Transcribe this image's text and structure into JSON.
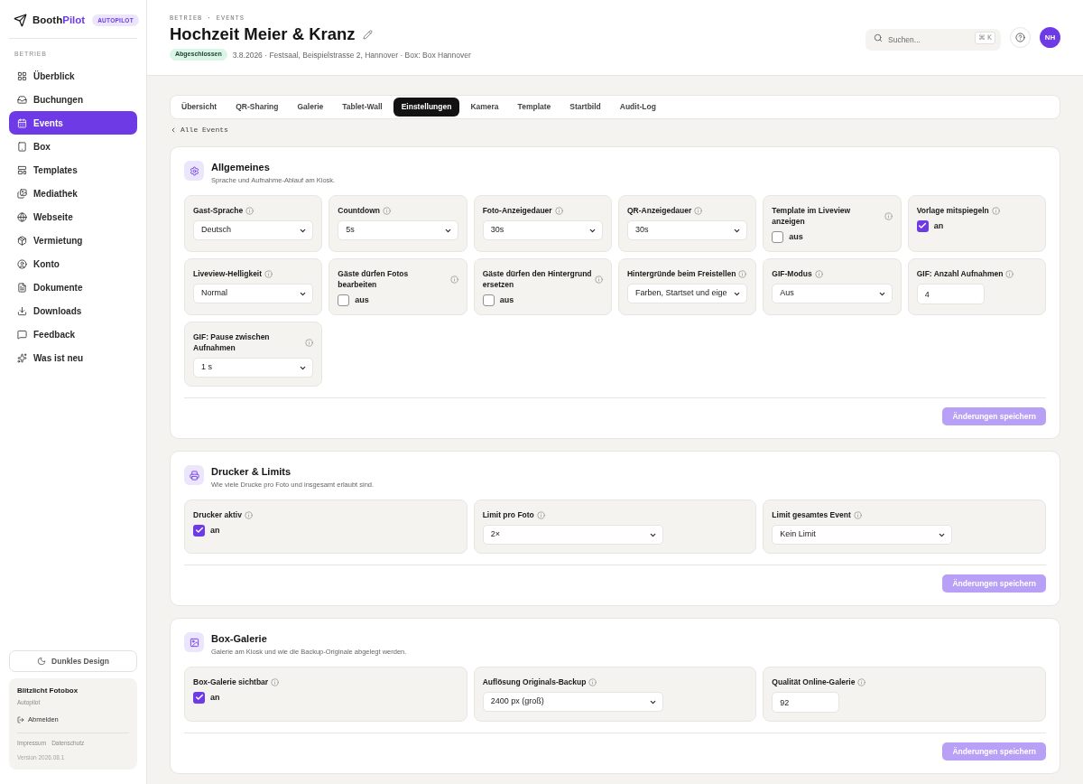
{
  "sidebar": {
    "brand": {
      "name": "Booth",
      "name_accent": "Pilot",
      "badge": "AUTOPILOT"
    },
    "section_label": "BETRIEB",
    "items": [
      {
        "label": "Überblick",
        "selected": false
      },
      {
        "label": "Buchungen",
        "selected": false
      },
      {
        "label": "Events",
        "selected": true
      },
      {
        "label": "Box",
        "selected": false
      },
      {
        "label": "Templates",
        "selected": false
      },
      {
        "label": "Mediathek",
        "selected": false
      },
      {
        "label": "Webseite",
        "selected": false
      },
      {
        "label": "Vermietung",
        "selected": false
      },
      {
        "label": "Konto",
        "selected": false
      },
      {
        "label": "Dokumente",
        "selected": false
      },
      {
        "label": "Downloads",
        "selected": false
      },
      {
        "label": "Feedback",
        "selected": false
      },
      {
        "label": "Was ist neu",
        "selected": false
      }
    ],
    "theme_button": "Dunkles Design",
    "account": {
      "name": "Blitzlicht Fotobox",
      "plan": "Autopilot",
      "logout": "Abmelden",
      "links": [
        "Impressum",
        "Datenschutz"
      ],
      "version": "Version 2026.08.1"
    }
  },
  "header": {
    "breadcrumb": "BETRIEB · EVENTS",
    "title": "Hochzeit Meier & Kranz",
    "status": "Abgeschlossen",
    "meta": "3.8.2026 · Festsaal, Beispielstrasse 2, Hannover · Box: Box Hannover",
    "search": {
      "placeholder": "Suchen...",
      "shortcut": "⌘ K"
    },
    "avatar": "NH"
  },
  "tabs": [
    {
      "label": "Übersicht",
      "selected": false
    },
    {
      "label": "QR-Sharing",
      "selected": false
    },
    {
      "label": "Galerie",
      "selected": false
    },
    {
      "label": "Tablet-Wall",
      "selected": false
    },
    {
      "label": "Einstellungen",
      "selected": true
    },
    {
      "label": "Kamera",
      "selected": false
    },
    {
      "label": "Template",
      "selected": false
    },
    {
      "label": "Startbild",
      "selected": false
    },
    {
      "label": "Audit-Log",
      "selected": false
    }
  ],
  "back_link": "Alle Events",
  "sections": [
    {
      "title": "Allgemeines",
      "subtitle": "Sprache und Aufnahme-Ablauf am Kiosk.",
      "fields": [
        {
          "kind": "select",
          "label": "Gast-Sprache",
          "value": "Deutsch"
        },
        {
          "kind": "select",
          "label": "Countdown",
          "value": "5s"
        },
        {
          "kind": "select",
          "label": "Foto-Anzeigedauer",
          "value": "30s"
        },
        {
          "kind": "select",
          "label": "QR-Anzeigedauer",
          "value": "30s"
        },
        {
          "kind": "checkbox",
          "label": "Template im Liveview anzeigen",
          "checked": false,
          "state_text": "aus"
        },
        {
          "kind": "checkbox",
          "label": "Vorlage mitspiegeln",
          "checked": true,
          "state_text": "an"
        },
        {
          "kind": "select",
          "label": "Liveview-Helligkeit",
          "value": "Normal"
        },
        {
          "kind": "checkbox",
          "label": "Gäste dürfen Fotos bearbeiten",
          "checked": false,
          "state_text": "aus"
        },
        {
          "kind": "checkbox",
          "label": "Gäste dürfen den Hintergrund ersetzen",
          "checked": false,
          "state_text": "aus"
        },
        {
          "kind": "select",
          "label": "Hintergründe beim Freistellen",
          "value": "Farben, Startset und eige"
        },
        {
          "kind": "select",
          "label": "GIF-Modus",
          "value": "Aus"
        },
        {
          "kind": "number",
          "label": "GIF: Anzahl Aufnahmen",
          "value": "4"
        },
        {
          "kind": "select",
          "label": "GIF: Pause zwischen Aufnahmen",
          "value": "1 s"
        }
      ],
      "save_button": {
        "label": "Änderungen speichern",
        "disabled": true
      }
    },
    {
      "title": "Drucker & Limits",
      "subtitle": "Wie viele Drucke pro Foto und insgesamt erlaubt sind.",
      "fields": [
        {
          "kind": "checkbox",
          "label": "Drucker aktiv",
          "checked": true,
          "state_text": "an"
        },
        {
          "kind": "select",
          "label": "Limit pro Foto",
          "value": "2×"
        },
        {
          "kind": "select",
          "label": "Limit gesamtes Event",
          "value": "Kein Limit"
        }
      ],
      "save_button": {
        "label": "Änderungen speichern",
        "disabled": true
      }
    },
    {
      "title": "Box-Galerie",
      "subtitle": "Galerie am Kiosk und wie die Backup-Originale abgelegt werden.",
      "fields": [
        {
          "kind": "checkbox",
          "label": "Box-Galerie sichtbar",
          "checked": true,
          "state_text": "an"
        },
        {
          "kind": "select",
          "label": "Auflösung Originals-Backup",
          "value": "2400 px (groß)"
        },
        {
          "kind": "number",
          "label": "Qualität Online-Galerie",
          "value": "92"
        }
      ],
      "save_button": {
        "label": "Änderungen speichern",
        "disabled": true
      }
    }
  ]
}
